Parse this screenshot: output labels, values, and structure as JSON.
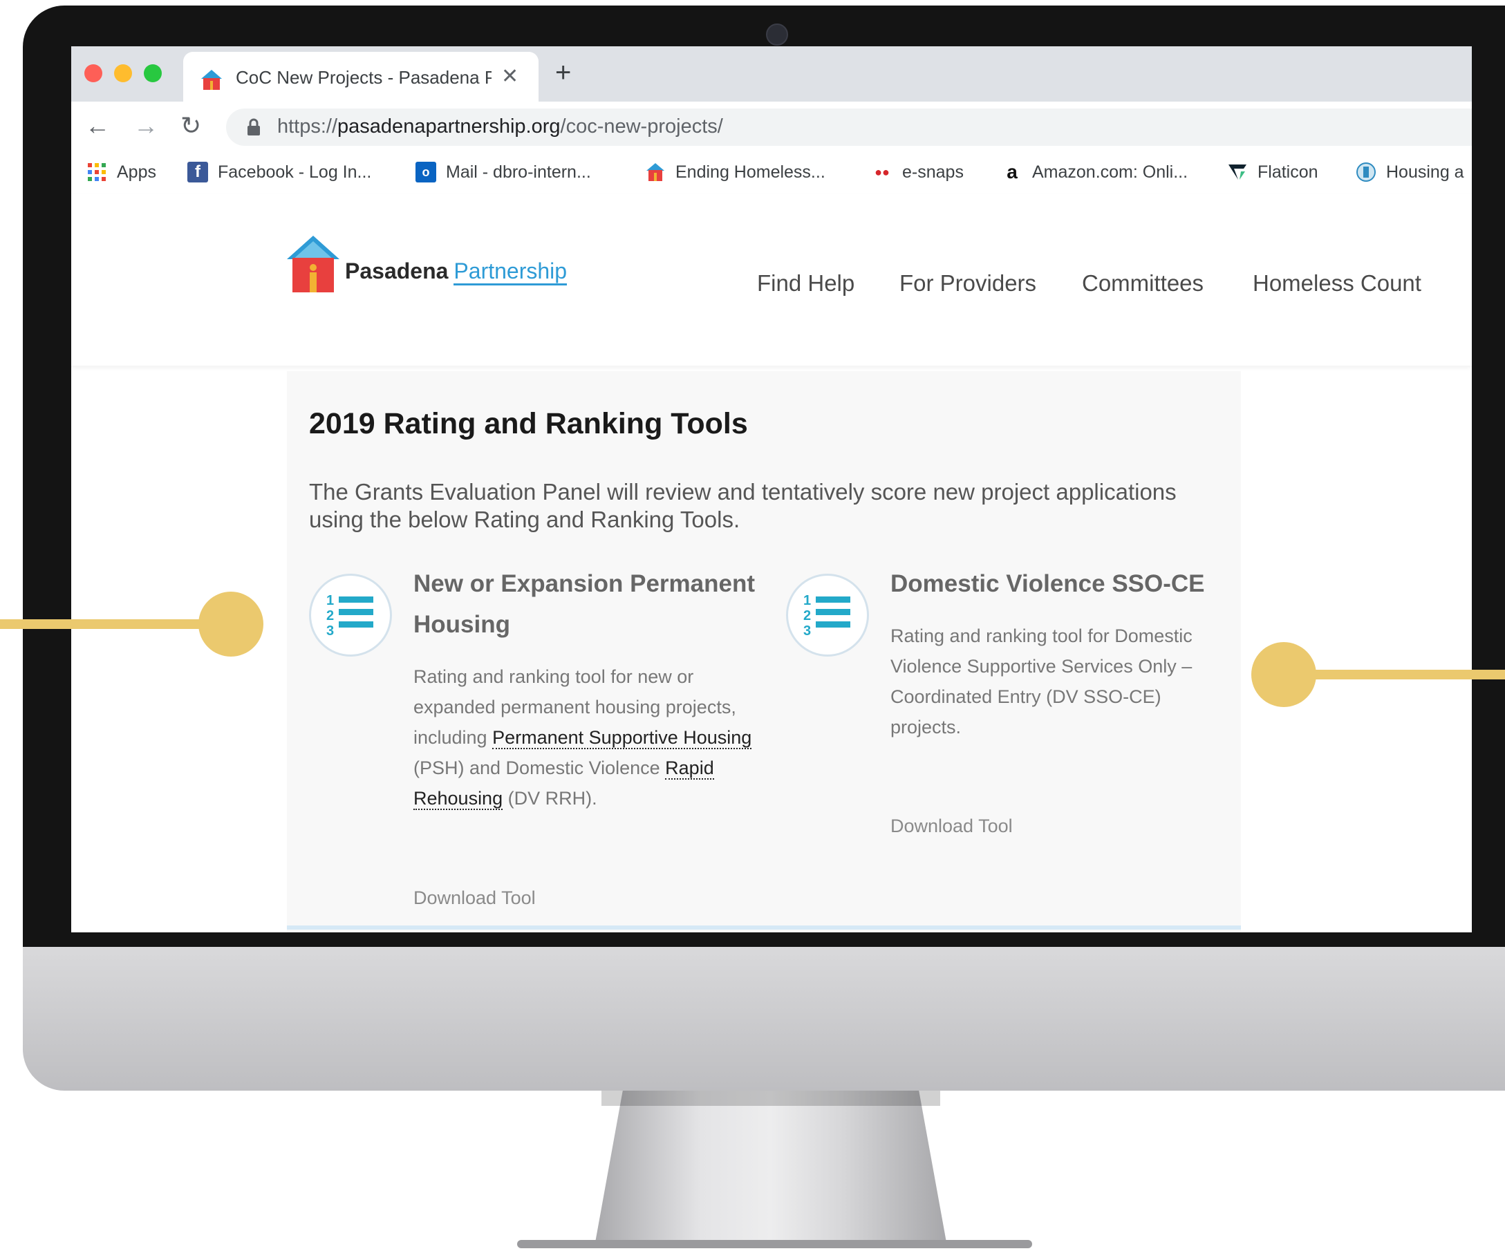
{
  "browser": {
    "tab_title": "CoC New Projects - Pasadena Partnership",
    "tab_close": "✕",
    "new_tab": "+",
    "url_scheme": "https://",
    "url_host": "pasadenapartnership.org",
    "url_path": "/coc-new-projects/",
    "nav_back": "←",
    "nav_forward": "→",
    "nav_reload": "↻",
    "bookmarks": [
      {
        "label": "Apps"
      },
      {
        "label": "Facebook - Log In..."
      },
      {
        "label": "Mail - dbro-intern..."
      },
      {
        "label": "Ending Homeless..."
      },
      {
        "label": "e-snaps"
      },
      {
        "label": "Amazon.com: Onli..."
      },
      {
        "label": "Flaticon"
      },
      {
        "label": "Housing a"
      }
    ]
  },
  "site": {
    "logo_word1": "Pasadena",
    "logo_word2": "Partnership",
    "menu": [
      "Find Help",
      "For Providers",
      "Committees",
      "Homeless Count"
    ]
  },
  "main": {
    "heading": "2019 Rating and Ranking Tools",
    "intro": "The Grants Evaluation Panel will review and tentatively score new project applications using the below Rating and Ranking Tools.",
    "tools": [
      {
        "title": "New or Expansion Permanent Housing",
        "desc_pre": "Rating and ranking tool for new or expanded permanent housing projects, including ",
        "link1": "Permanent Supportive Housing",
        "desc_mid": " (PSH) and Domestic Violence ",
        "link2": "Rapid Rehousing",
        "desc_post": " (DV RRH).",
        "download": "Download Tool"
      },
      {
        "title": "Domestic Violence SSO-CE",
        "desc": "Rating and ranking tool for Domestic Violence Supportive Services Only – Coordinated Entry (DV SSO-CE) projects.",
        "download": "Download Tool"
      }
    ]
  },
  "colors": {
    "accent_yellow": "#ebc96e",
    "brand_blue": "#2e9bd6",
    "icon_teal": "#23a9c9"
  },
  "icons": [
    "list-numbered-icon",
    "lock-icon",
    "house-icon",
    "apps-grid-icon"
  ]
}
